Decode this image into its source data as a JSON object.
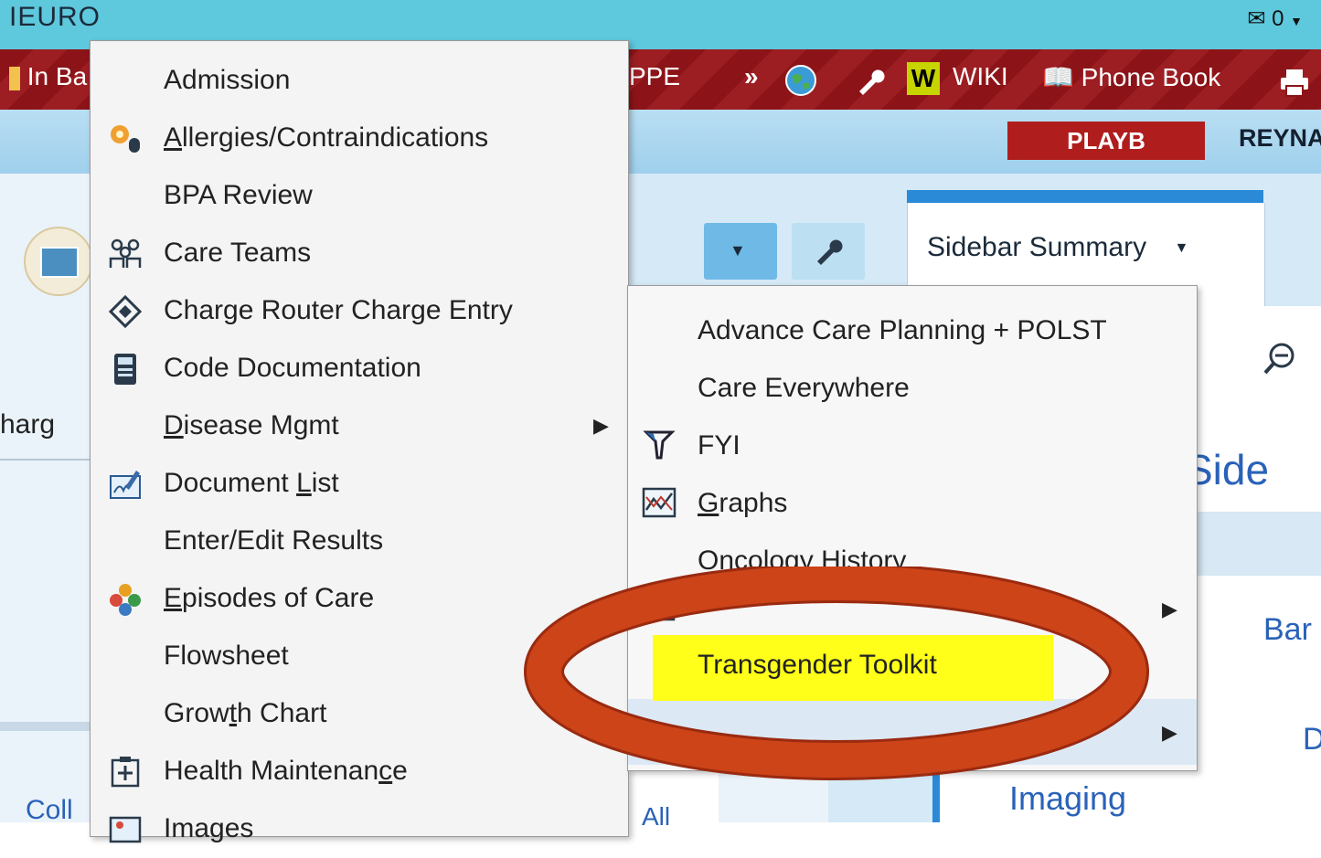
{
  "app": {
    "title": "IEURO",
    "mail_count": "0"
  },
  "toolbar": {
    "in_basket": "In Ba",
    "ppe": "PPE",
    "more": "»",
    "wiki": "WIKI",
    "wiki_badge": "W",
    "phone_book": "Phone Book"
  },
  "header": {
    "badge": "PLAYB",
    "user": "REYNA"
  },
  "background": {
    "charge": "harg",
    "coll": "Coll",
    "sidebar_tab": "Sidebar Summary",
    "side": "Side",
    "bar": "Bar",
    "d": "D",
    "imaging": "Imaging",
    "all": "All"
  },
  "main_menu": {
    "items": [
      {
        "label": "Admission",
        "icon": "none"
      },
      {
        "label": "Allergies/Contraindications",
        "icon": "allergy-icon"
      },
      {
        "label": "BPA Review",
        "icon": "none"
      },
      {
        "label": "Care Teams",
        "icon": "care-teams-icon"
      },
      {
        "label": "Charge Router Charge Entry",
        "icon": "diamond-icon"
      },
      {
        "label": "Code Documentation",
        "icon": "calculator-icon"
      },
      {
        "label": "Disease Mgmt",
        "icon": "none",
        "submenu": true
      },
      {
        "label": "Document List",
        "icon": "document-list-icon"
      },
      {
        "label": "Enter/Edit Results",
        "icon": "none"
      },
      {
        "label": "Episodes of Care",
        "icon": "episodes-icon"
      },
      {
        "label": "Flowsheet",
        "icon": "none"
      },
      {
        "label": "Growth Chart",
        "icon": "none"
      },
      {
        "label": "Health Maintenance",
        "icon": "health-maintenance-icon"
      },
      {
        "label": "Images",
        "icon": "images-icon"
      }
    ]
  },
  "sub_menu": {
    "items": [
      {
        "label": "Advance Care Planning + POLST",
        "icon": "none"
      },
      {
        "label": "Care Everywhere",
        "icon": "none"
      },
      {
        "label": "FYI",
        "icon": "fyi-flag-icon"
      },
      {
        "label": "Graphs",
        "icon": "graph-icon"
      },
      {
        "label": "Oncology History",
        "icon": "none"
      },
      {
        "label": "Transgender Toolkit",
        "icon": "none",
        "highlighted": true
      }
    ]
  },
  "colors": {
    "topbar": "#5ec8dd",
    "redbar": "#8c1418",
    "highlight": "#ffff1a",
    "annotation_ring": "#cc4418"
  }
}
